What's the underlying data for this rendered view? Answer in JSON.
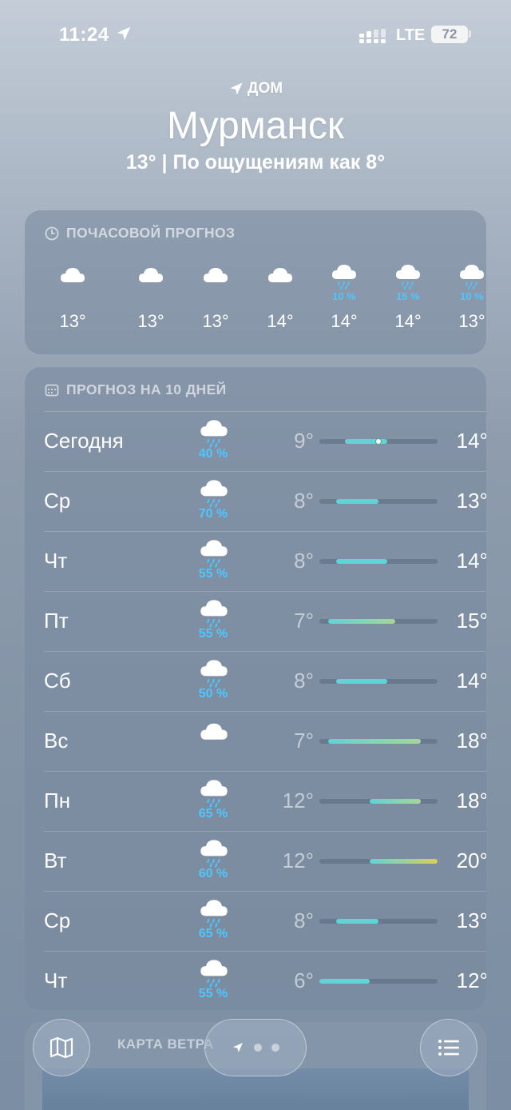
{
  "status": {
    "time": "11:24",
    "network": "LTE",
    "battery": "72"
  },
  "header": {
    "home_label": "ДОМ",
    "city": "Мурманск",
    "summary": "13°  |  По ощущениям как 8°"
  },
  "hourly": {
    "title": "ПОЧАСОВОЙ ПРОГНОЗ",
    "items": [
      {
        "icon": "cloud-icon",
        "pop": "",
        "temp": "13°"
      },
      {
        "icon": "cloud-icon",
        "pop": "",
        "temp": "13°"
      },
      {
        "icon": "cloud-icon",
        "pop": "",
        "temp": "13°"
      },
      {
        "icon": "cloud-icon",
        "pop": "",
        "temp": "14°"
      },
      {
        "icon": "rain-cloud-icon",
        "pop": "10 %",
        "temp": "14°"
      },
      {
        "icon": "rain-cloud-icon",
        "pop": "15 %",
        "temp": "14°"
      },
      {
        "icon": "rain-cloud-icon",
        "pop": "10 %",
        "temp": "13°"
      }
    ]
  },
  "daily": {
    "title": "ПРОГНОЗ НА 10 ДНЕЙ",
    "range_min": 6,
    "range_max": 20,
    "days": [
      {
        "name": "Сегодня",
        "icon": "rain-cloud-icon",
        "pop": "40 %",
        "low": "9°",
        "high": "14°",
        "low_val": 9,
        "high_val": 14,
        "current": 13
      },
      {
        "name": "Ср",
        "icon": "rain-cloud-icon",
        "pop": "70 %",
        "low": "8°",
        "high": "13°",
        "low_val": 8,
        "high_val": 13
      },
      {
        "name": "Чт",
        "icon": "rain-cloud-icon",
        "pop": "55 %",
        "low": "8°",
        "high": "14°",
        "low_val": 8,
        "high_val": 14
      },
      {
        "name": "Пт",
        "icon": "rain-cloud-icon",
        "pop": "55 %",
        "low": "7°",
        "high": "15°",
        "low_val": 7,
        "high_val": 15
      },
      {
        "name": "Сб",
        "icon": "rain-cloud-icon",
        "pop": "50 %",
        "low": "8°",
        "high": "14°",
        "low_val": 8,
        "high_val": 14
      },
      {
        "name": "Вс",
        "icon": "cloud-icon",
        "pop": "",
        "low": "7°",
        "high": "18°",
        "low_val": 7,
        "high_val": 18
      },
      {
        "name": "Пн",
        "icon": "rain-cloud-icon",
        "pop": "65 %",
        "low": "12°",
        "high": "18°",
        "low_val": 12,
        "high_val": 18
      },
      {
        "name": "Вт",
        "icon": "rain-cloud-icon",
        "pop": "60 %",
        "low": "12°",
        "high": "20°",
        "low_val": 12,
        "high_val": 20
      },
      {
        "name": "Ср",
        "icon": "rain-cloud-icon",
        "pop": "65 %",
        "low": "8°",
        "high": "13°",
        "low_val": 8,
        "high_val": 13
      },
      {
        "name": "Чт",
        "icon": "rain-cloud-icon",
        "pop": "55 %",
        "low": "6°",
        "high": "12°",
        "low_val": 6,
        "high_val": 12
      }
    ]
  },
  "wind": {
    "title": "КАРТА ВЕТРА"
  },
  "colors": {
    "precip": "#4ec7ff",
    "cool": "#5fd3d6",
    "warm": "#d9cf55"
  }
}
